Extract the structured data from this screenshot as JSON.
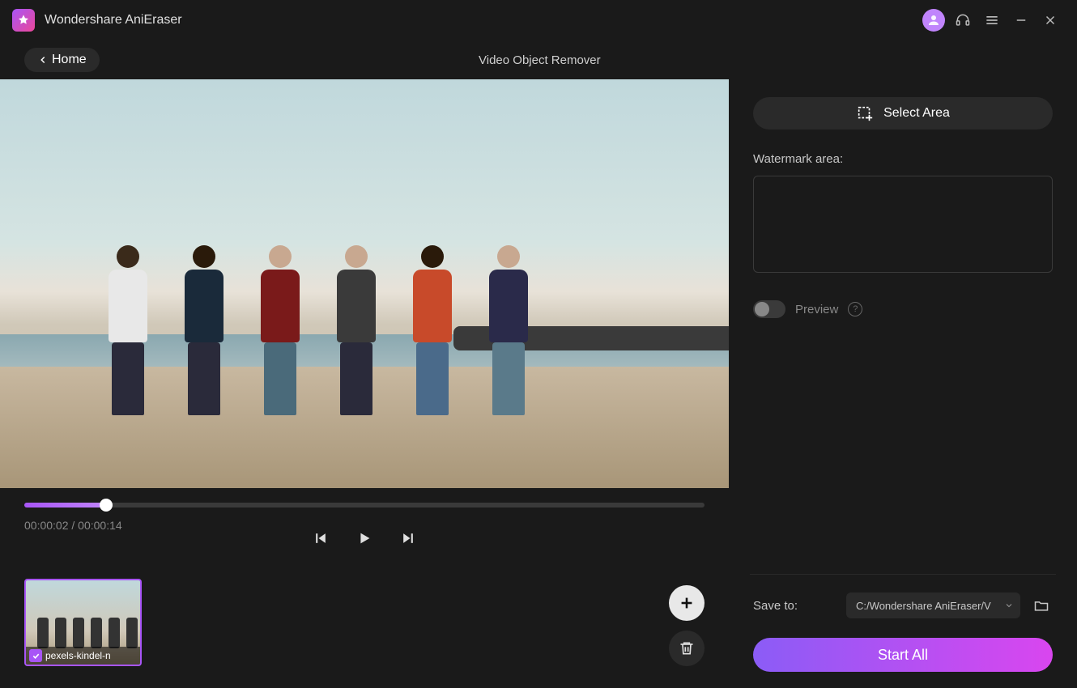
{
  "app": {
    "title": "Wondershare AniEraser"
  },
  "nav": {
    "home_label": "Home",
    "page_title": "Video Object Remover"
  },
  "video": {
    "current_time": "00:00:02",
    "duration": "00:00:14",
    "timestamp_display": "00:00:02 / 00:00:14",
    "seek_percent": 12
  },
  "clips": [
    {
      "filename": "pexels-kindel-n",
      "selected": true
    }
  ],
  "sidebar": {
    "select_area_label": "Select Area",
    "watermark_label": "Watermark area:",
    "preview_label": "Preview",
    "preview_enabled": false
  },
  "output": {
    "save_to_label": "Save to:",
    "save_path": "C:/Wondershare AniEraser/V",
    "start_label": "Start All"
  },
  "colors": {
    "accent": "#a855f7",
    "accent2": "#d946ef"
  }
}
